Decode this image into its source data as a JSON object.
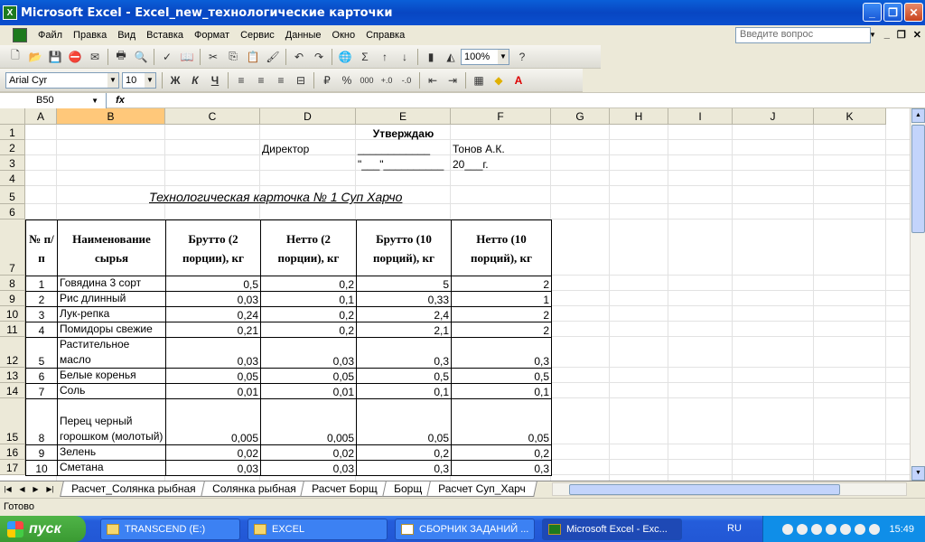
{
  "window": {
    "title": "Microsoft Excel - Excel_new_технологические карточки"
  },
  "menu": [
    "Файл",
    "Правка",
    "Вид",
    "Вставка",
    "Формат",
    "Сервис",
    "Данные",
    "Окно",
    "Справка"
  ],
  "help_placeholder": "Введите вопрос",
  "toolbar": {
    "zoom": "100%",
    "font": "Arial Cyr",
    "size": "10",
    "bold": "Ж",
    "italic": "К",
    "underline": "Ч",
    "percent": "%",
    "thousands": "000"
  },
  "formula": {
    "cell_ref": "B50",
    "fx": "fx",
    "content": ""
  },
  "columns": [
    "A",
    "B",
    "C",
    "D",
    "E",
    "F",
    "G",
    "H",
    "I",
    "J",
    "K"
  ],
  "rows": [
    "1",
    "2",
    "3",
    "4",
    "5",
    "6",
    "7",
    "8",
    "9",
    "10",
    "11",
    "12",
    "13",
    "14",
    "15",
    "16",
    "17"
  ],
  "header_block": {
    "approve": "Утверждаю",
    "director": "Директор",
    "signature_line": "____________",
    "director_name": "Тонов А.К.",
    "date_line": "\"___\"__________",
    "year": "20___г."
  },
  "card_title": "Технологическая карточка № 1 Суп Харчо",
  "table": {
    "headers": [
      "№ п/п",
      "Наименование сырья",
      "Брутто (2 порции), кг",
      "Нетто (2 порции), кг",
      "Брутто (10 порций), кг",
      "Нетто (10 порций), кг"
    ],
    "rows": [
      {
        "n": "1",
        "name": "Говядина 3 сорт",
        "b2": "0,5",
        "n2": "0,2",
        "b10": "5",
        "n10": "2"
      },
      {
        "n": "2",
        "name": "Рис длинный",
        "b2": "0,03",
        "n2": "0,1",
        "b10": "0,33",
        "n10": "1"
      },
      {
        "n": "3",
        "name": "Лук-репка",
        "b2": "0,24",
        "n2": "0,2",
        "b10": "2,4",
        "n10": "2"
      },
      {
        "n": "4",
        "name": "Помидоры свежие",
        "b2": "0,21",
        "n2": "0,2",
        "b10": "2,1",
        "n10": "2"
      },
      {
        "n": "5",
        "name": "Растительное масло",
        "b2": "0,03",
        "n2": "0,03",
        "b10": "0,3",
        "n10": "0,3"
      },
      {
        "n": "6",
        "name": "Белые коренья",
        "b2": "0,05",
        "n2": "0,05",
        "b10": "0,5",
        "n10": "0,5"
      },
      {
        "n": "7",
        "name": "Соль",
        "b2": "0,01",
        "n2": "0,01",
        "b10": "0,1",
        "n10": "0,1"
      },
      {
        "n": "8",
        "name": "Перец черный горошком (молотый)",
        "b2": "0,005",
        "n2": "0,005",
        "b10": "0,05",
        "n10": "0,05"
      },
      {
        "n": "9",
        "name": "Зелень",
        "b2": "0,02",
        "n2": "0,02",
        "b10": "0,2",
        "n10": "0,2"
      },
      {
        "n": "10",
        "name": "Сметана",
        "b2": "0,03",
        "n2": "0,03",
        "b10": "0,3",
        "n10": "0,3"
      }
    ]
  },
  "sheet_tabs": [
    "Расчет_Солянка рыбная",
    "Солянка рыбная",
    "Расчет Борщ",
    "Борщ",
    "Расчет Суп_Харч"
  ],
  "status": "Готово",
  "taskbar": {
    "start": "пуск",
    "items": [
      "TRANSCEND (E:)",
      "EXCEL",
      "СБОРНИК ЗАДАНИЙ ...",
      "Microsoft Excel - Exc..."
    ],
    "lang": "RU",
    "clock": "15:49"
  }
}
